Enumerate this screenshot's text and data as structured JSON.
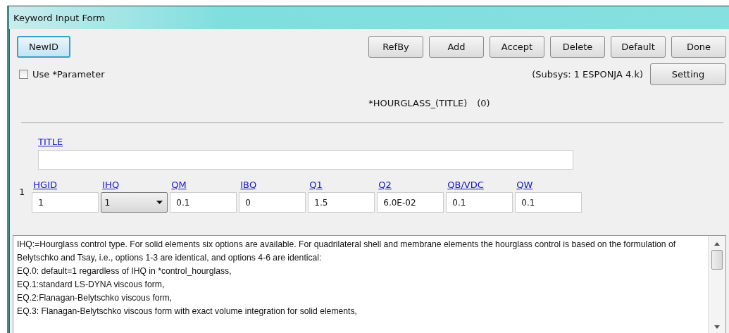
{
  "window": {
    "title": "Keyword Input Form"
  },
  "toolbar": {
    "left_button": "NewID",
    "buttons": [
      "RefBy",
      "Add",
      "Accept",
      "Delete",
      "Default",
      "Done"
    ]
  },
  "use_parameter": {
    "label": "Use *Parameter",
    "checked": false
  },
  "subsys": "(Subsys: 1 ESPONJA  4.k)",
  "setting_button": "Setting",
  "keyword": {
    "name": "*HOURGLASS_(TITLE)",
    "count": "(0)"
  },
  "title_field": {
    "label": "TITLE"
  },
  "card": {
    "number": "1",
    "fields": [
      {
        "label": "HGID",
        "value": "1",
        "kind": "text"
      },
      {
        "label": "IHQ",
        "value": "1",
        "kind": "dropdown"
      },
      {
        "label": "QM",
        "value": "0.1",
        "kind": "text"
      },
      {
        "label": "IBQ",
        "value": "0",
        "kind": "text"
      },
      {
        "label": "Q1",
        "value": "1.5",
        "kind": "text"
      },
      {
        "label": "Q2",
        "value": "6.0E-02",
        "kind": "text"
      },
      {
        "label": "QB/VDC",
        "value": "0.1",
        "kind": "text"
      },
      {
        "label": "QW",
        "value": "0.1",
        "kind": "text"
      }
    ]
  },
  "help_text": [
    "IHQ:=Hourglass control type. For solid elements six options are available. For quadrilateral shell and membrane elements the hourglass control is based on the formulation of Belytschko and Tsay, i.e., options 1-3 are identical, and options 4-6 are identical:",
    "EQ.0: default=1 regardless of IHQ in *control_hourglass,",
    "EQ.1:standard LS-DYNA viscous form,",
    "EQ.2:Flanagan-Belytschko viscous form,",
    "EQ.3: Flanagan-Belytschko viscous form with exact volume integration for solid elements,"
  ]
}
